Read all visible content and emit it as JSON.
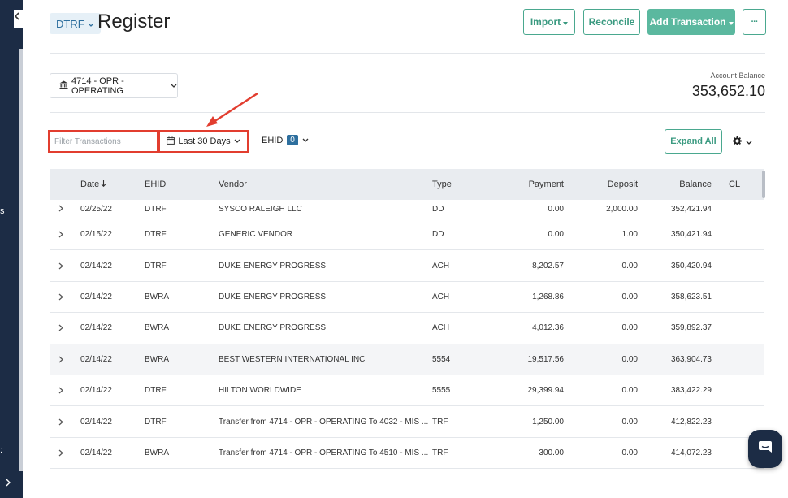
{
  "header": {
    "entity": "DTRF",
    "title": "Register",
    "import_label": "Import",
    "reconcile_label": "Reconcile",
    "add_transaction_label": "Add Transaction",
    "more_label": "···"
  },
  "account": {
    "selected": "4714 - OPR - OPERATING",
    "balance_label": "Account Balance",
    "balance_value": "353,652.10"
  },
  "filters": {
    "search_placeholder": "Filter Transactions",
    "date_range": "Last 30 Days",
    "ehid_label": "EHID",
    "ehid_count": "0",
    "expand_all": "Expand All"
  },
  "sidebar": {
    "partial_text_1": "s",
    "partial_text_2": ":"
  },
  "table": {
    "headers": {
      "date": "Date",
      "ehid": "EHID",
      "vendor": "Vendor",
      "type": "Type",
      "payment": "Payment",
      "deposit": "Deposit",
      "balance": "Balance",
      "cl": "CL"
    },
    "rows": [
      {
        "date": "02/25/22",
        "ehid": "DTRF",
        "vendor": "SYSCO RALEIGH LLC",
        "type": "DD",
        "payment": "0.00",
        "deposit": "2,000.00",
        "balance": "352,421.94"
      },
      {
        "date": "02/15/22",
        "ehid": "DTRF",
        "vendor": "GENERIC VENDOR",
        "type": "DD",
        "payment": "0.00",
        "deposit": "1.00",
        "balance": "350,421.94"
      },
      {
        "date": "02/14/22",
        "ehid": "DTRF",
        "vendor": "DUKE ENERGY PROGRESS",
        "type": "ACH",
        "payment": "8,202.57",
        "deposit": "0.00",
        "balance": "350,420.94"
      },
      {
        "date": "02/14/22",
        "ehid": "BWRA",
        "vendor": "DUKE ENERGY PROGRESS",
        "type": "ACH",
        "payment": "1,268.86",
        "deposit": "0.00",
        "balance": "358,623.51"
      },
      {
        "date": "02/14/22",
        "ehid": "BWRA",
        "vendor": "DUKE ENERGY PROGRESS",
        "type": "ACH",
        "payment": "4,012.36",
        "deposit": "0.00",
        "balance": "359,892.37"
      },
      {
        "date": "02/14/22",
        "ehid": "BWRA",
        "vendor": "BEST WESTERN INTERNATIONAL INC",
        "type": "5554",
        "payment": "19,517.56",
        "deposit": "0.00",
        "balance": "363,904.73"
      },
      {
        "date": "02/14/22",
        "ehid": "DTRF",
        "vendor": "HILTON WORLDWIDE",
        "type": "5555",
        "payment": "29,399.94",
        "deposit": "0.00",
        "balance": "383,422.29"
      },
      {
        "date": "02/14/22",
        "ehid": "DTRF",
        "vendor": "Transfer from 4714 - OPR - OPERATING To 4032 - MIS ...",
        "type": "TRF",
        "payment": "1,250.00",
        "deposit": "0.00",
        "balance": "412,822.23"
      },
      {
        "date": "02/14/22",
        "ehid": "BWRA",
        "vendor": "Transfer from 4714 - OPR - OPERATING To 4510 - MIS ...",
        "type": "TRF",
        "payment": "300.00",
        "deposit": "0.00",
        "balance": "414,072.23"
      }
    ]
  },
  "colors": {
    "accent": "#5bb89f",
    "sidebar": "#1c2c45",
    "annotation": "#e23d2f",
    "link_blue": "#2e6f9e"
  }
}
